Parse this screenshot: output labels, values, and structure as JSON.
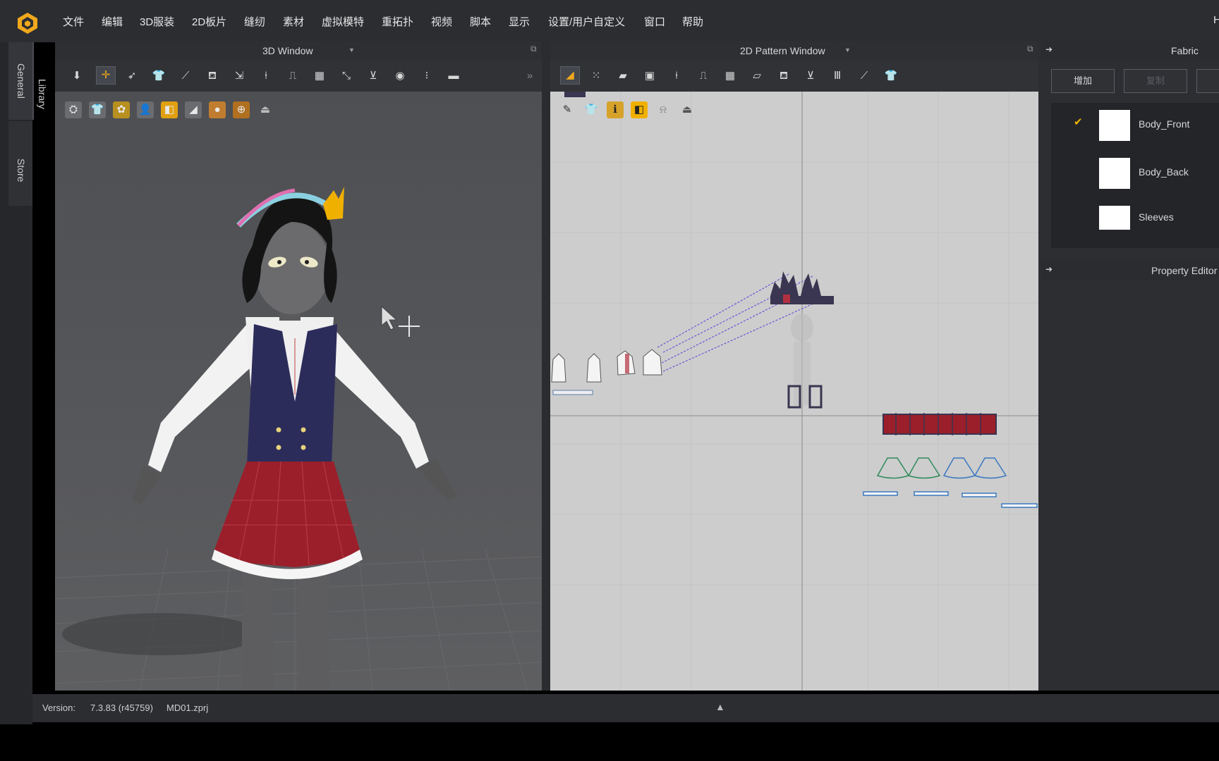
{
  "menu": {
    "items": [
      "文件",
      "编辑",
      "3D服装",
      "2D板片",
      "缝纫",
      "素材",
      "虚拟模特",
      "重拓扑",
      "视频",
      "脚本",
      "显示",
      "设置/用户自定义",
      "窗口",
      "帮助"
    ],
    "truncated_right": "H"
  },
  "left_dock": {
    "tab_general": "General",
    "tab_library": "Library",
    "tab_store": "Store"
  },
  "window_3d": {
    "title": "3D Window"
  },
  "window_2d": {
    "title": "2D Pattern Window"
  },
  "fabric_panel": {
    "title": "Fabric",
    "add_label": "增加",
    "second_label": "复制",
    "items": [
      {
        "name": "Body_Front",
        "selected": true
      },
      {
        "name": "Body_Back",
        "selected": false
      },
      {
        "name": "Sleeves",
        "selected": false
      }
    ],
    "check_mark": "✔",
    "check_color": "#f0b400"
  },
  "property_editor": {
    "title": "Property Editor"
  },
  "status": {
    "version_label": "Version:",
    "version_value": "7.3.83 (r45759)",
    "file_name": "MD01.zprj"
  },
  "colors": {
    "accent_orange": "#f0a81c",
    "pattern_line": "#6a55d8",
    "vest_navy": "#2b2c5a",
    "skirt_red": "#9a1f2a"
  }
}
